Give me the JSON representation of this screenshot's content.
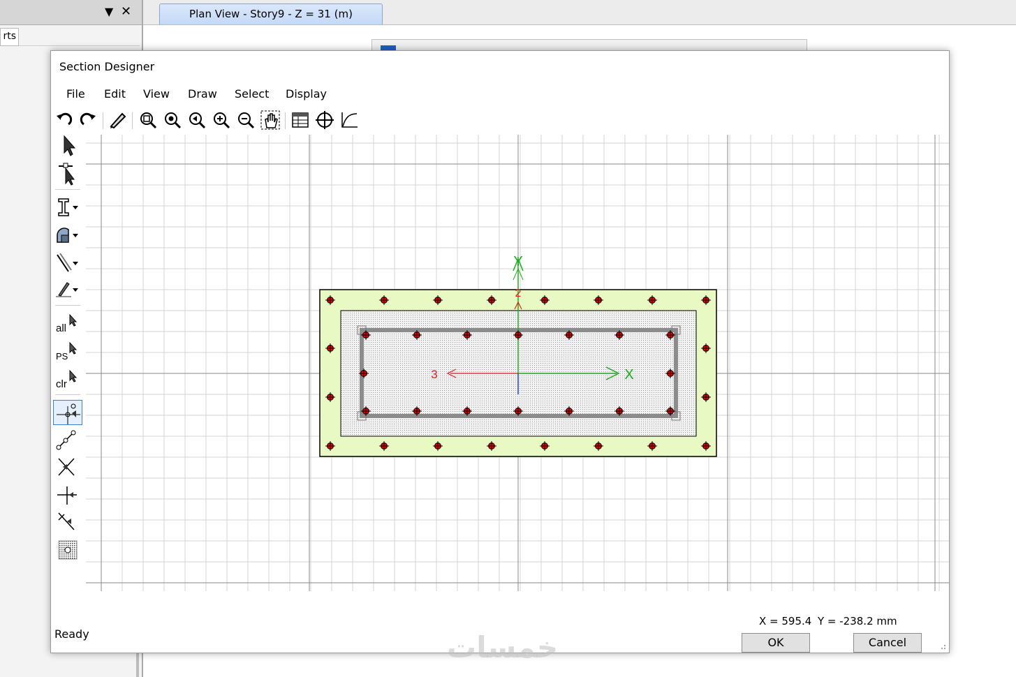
{
  "background": {
    "left_tab_partial": "rts",
    "doc_tab_title": "Plan View - Story9 - Z = 31 (m)",
    "watermark": "خمسات"
  },
  "dialog": {
    "title": "Section Designer",
    "menu": [
      "File",
      "Edit",
      "View",
      "Draw",
      "Select",
      "Display"
    ],
    "status": "Ready",
    "coord_x": "X = 595.4",
    "coord_y": "Y = -238.2 mm",
    "ok_label": "OK",
    "cancel_label": "Cancel"
  },
  "toolbar_icons": [
    "undo-icon",
    "redo-icon",
    "pencil-icon",
    "zoom-window-icon",
    "zoom-restore-icon",
    "zoom-previous-icon",
    "zoom-in-icon",
    "zoom-out-icon",
    "pan-icon",
    "table-icon",
    "snap-icon",
    "graph-icon"
  ],
  "sidebar_icons": [
    "pointer-icon",
    "reshape-icon",
    "draw-i-section-icon",
    "draw-shape-icon",
    "draw-line-icon",
    "draw-polyline-icon",
    "select-all-icon",
    "select-previous-icon",
    "clear-selection-icon",
    "snap-point-icon",
    "snap-line-icon",
    "snap-intersection-icon",
    "snap-perpendicular-icon",
    "snap-end-icon",
    "snap-grid-icon"
  ],
  "sidebar_labels": {
    "all": "all",
    "ps": "PS",
    "clr": "clr"
  },
  "section": {
    "axis_y_label": "Y",
    "axis_x_label": "X",
    "axis_2_label": "2",
    "axis_3_label": "3",
    "colors": {
      "concrete_fill": "#e8f9c4",
      "concrete_edge": "#000000",
      "core_fill": "#dddddd",
      "tube_stroke": "#8c8c8c",
      "rebar": "#e00000",
      "axis_x": "#22aa22",
      "axis_y": "#22aa22",
      "axis_local": "#e02020",
      "axis_z": "#2040e0",
      "grid_minor": "#d4d4d4",
      "grid_major": "#8a8a8a"
    }
  }
}
